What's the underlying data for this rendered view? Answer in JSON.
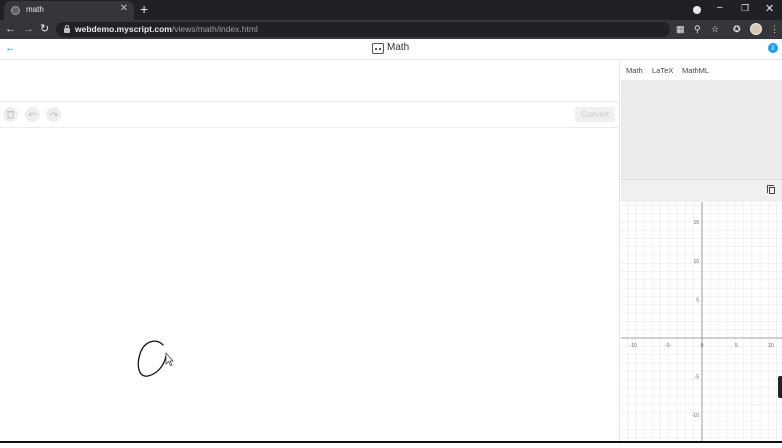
{
  "browser": {
    "tab_title": "math",
    "tab_close": "✕",
    "new_tab": "+",
    "url_host": "webdemo.myscript.com",
    "url_path": "/views/math/index.html",
    "icons": [
      "back-icon",
      "forward-icon",
      "reload-icon",
      "lock-icon",
      "translate-icon",
      "zoom-icon",
      "star-icon",
      "extensions-icon",
      "menu-icon"
    ],
    "window_controls": {
      "minimize": "–",
      "restore": "❐",
      "close": "✕"
    }
  },
  "app": {
    "back": "←",
    "title": "Math",
    "info": "i",
    "toolbar": {
      "clear": "🗑",
      "undo": "↶",
      "redo": "↷",
      "convert_label": "Convert"
    },
    "result_tabs": [
      "Math",
      "LaTeX",
      "MathML"
    ],
    "graph": {
      "x_ticks": [
        "-10",
        "-5",
        "0",
        "5",
        "10"
      ],
      "y_ticks": [
        "15",
        "10",
        "5",
        "-5",
        "-10"
      ]
    }
  },
  "colors": {
    "accent": "#1a9fff",
    "chrome_dark": "#202124",
    "chrome_toolbar": "#35363a"
  }
}
